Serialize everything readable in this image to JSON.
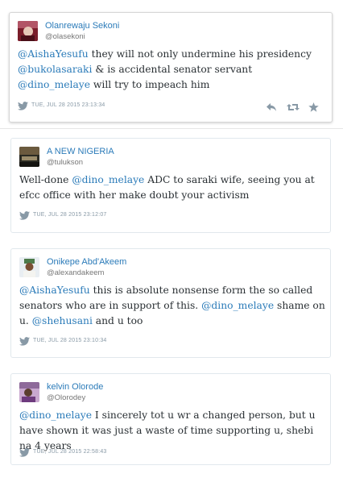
{
  "tweets": [
    {
      "name": "Olanrewaju Sekoni",
      "handle": "@olasekoni",
      "parts": [
        {
          "t": "@AishaYesufu",
          "m": true
        },
        {
          "t": " they will not only undermine his presidency "
        },
        {
          "t": "@bukolasaraki",
          "m": true
        },
        {
          "t": " & is accidental senator servant "
        },
        {
          "t": "@dino_melaye",
          "m": true
        },
        {
          "t": " will try to impeach him"
        }
      ],
      "date": "TUE, JUL 28 2015 23:13:34"
    },
    {
      "name": "A NEW NIGERIA",
      "handle": "@tulukson",
      "parts": [
        {
          "t": "Well-done "
        },
        {
          "t": "@dino_melaye",
          "m": true
        },
        {
          "t": " ADC to saraki wife, seeing you at efcc office with her make doubt your activism"
        }
      ],
      "date": "TUE, JUL 28 2015 23:12:07"
    },
    {
      "name": "Onikepe Abd'Akeem",
      "handle": "@alexandakeem",
      "parts": [
        {
          "t": "@AishaYesufu",
          "m": true
        },
        {
          "t": " this is absolute nonsense form the so called senators who are in support of this. "
        },
        {
          "t": "@dino_melaye",
          "m": true
        },
        {
          "t": " shame on u. "
        },
        {
          "t": "@shehusani",
          "m": true
        },
        {
          "t": " and u too"
        }
      ],
      "date": "TUE, JUL 28 2015 23:10:34"
    },
    {
      "name": "kelvin Olorode",
      "handle": "@Olorodey",
      "parts": [
        {
          "t": "@dino_melaye",
          "m": true
        },
        {
          "t": " I sincerely tot u wr a changed person, but u have shown it was just a waste of time supporting u, shebi na 4 years"
        }
      ],
      "date": "TUE, JUL 28 2015 22:58:43"
    }
  ],
  "icons": {
    "bird": "twitter-bird-icon",
    "reply": "reply-icon",
    "retweet": "retweet-icon",
    "favorite": "favorite-star-icon"
  },
  "colors": {
    "link": "#2b7bb9",
    "text": "#292f33",
    "meta": "#8899a6"
  }
}
